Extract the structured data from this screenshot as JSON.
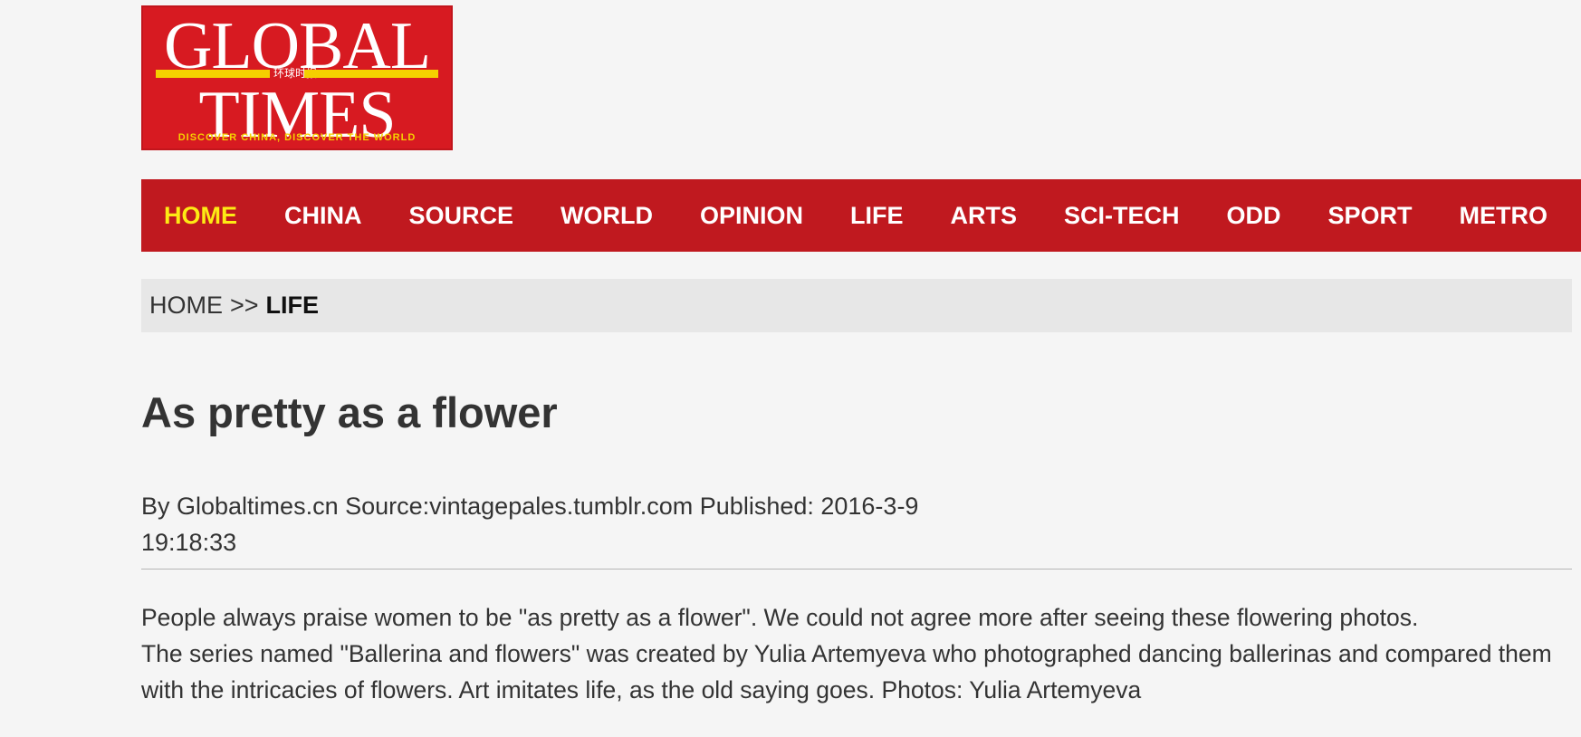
{
  "logo": {
    "line1": "GLOBAL",
    "line2": "TIMES",
    "chinese": "环球时报",
    "tagline": "DISCOVER CHINA, DISCOVER THE WORLD",
    "colors": {
      "background": "#d71a21",
      "accent": "#f5d000"
    }
  },
  "nav": {
    "items": [
      {
        "label": "HOME",
        "active": true
      },
      {
        "label": "CHINA"
      },
      {
        "label": "SOURCE"
      },
      {
        "label": "WORLD"
      },
      {
        "label": "OPINION"
      },
      {
        "label": "LIFE"
      },
      {
        "label": "ARTS"
      },
      {
        "label": "SCI-TECH"
      },
      {
        "label": "ODD"
      },
      {
        "label": "SPORT"
      },
      {
        "label": "METRO"
      }
    ],
    "colors": {
      "background": "#c0191f",
      "active": "#fdea14",
      "text": "#ffffff"
    }
  },
  "breadcrumb": {
    "home": "HOME",
    "separator": ">>",
    "current": "LIFE"
  },
  "article": {
    "title": "As pretty as a flower",
    "byline_line1": "By Globaltimes.cn Source:vintagepales.tumblr.com Published: 2016-3-9",
    "byline_line2": "19:18:33",
    "paragraph1": "People always praise women to be \"as pretty as a flower\". We could not agree more after seeing these flowering photos.",
    "paragraph2": "The series named \"Ballerina and flowers\" was created by Yulia Artemyeva who photographed dancing ballerinas and compared them with the intricacies of flowers. Art imitates life, as the old saying goes. Photos: Yulia Artemyeva"
  }
}
